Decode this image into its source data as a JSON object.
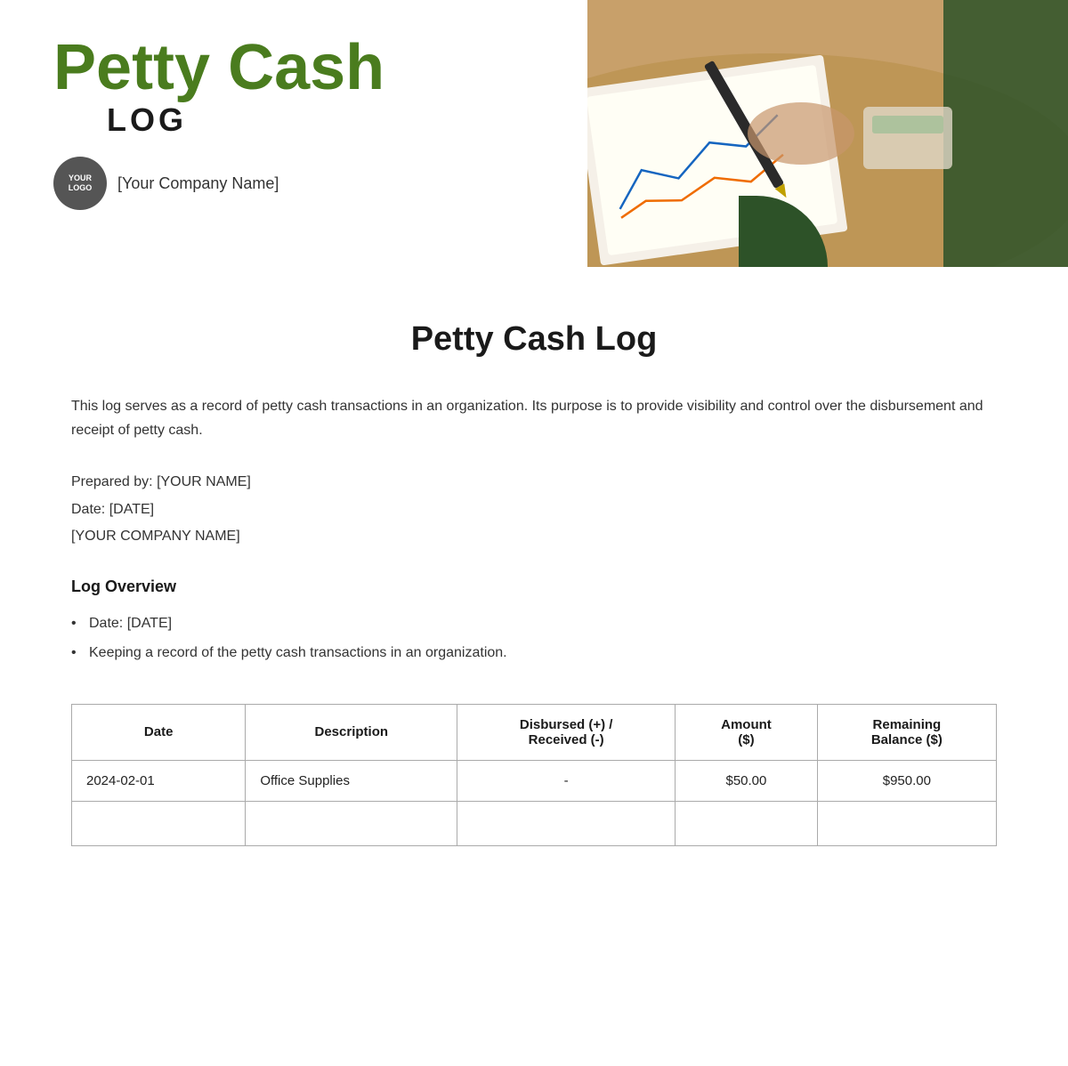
{
  "header": {
    "title_line1": "Petty Cash",
    "title_line2": "LOG",
    "logo_text_line1": "YOUR",
    "logo_text_line2": "LOGO",
    "company_name": "[Your Company Name]"
  },
  "document": {
    "main_title": "Petty Cash Log",
    "description": "This log serves as a record of petty cash transactions in an organization. Its purpose is to provide visibility and control over the disbursement and receipt of petty cash.",
    "prepared_by_label": "Prepared by:",
    "prepared_by_value": "[YOUR NAME]",
    "date_label": "Date:",
    "date_value": "[DATE]",
    "company_name_field": "[YOUR COMPANY NAME]",
    "section_heading": "Log Overview",
    "bullets": [
      "Date: [DATE]",
      "Keeping a record of the petty cash transactions in an organization."
    ]
  },
  "table": {
    "headers": [
      "Date",
      "Description",
      "Disbursed (+) / Received (-)",
      "Amount ($)",
      "Remaining Balance ($)"
    ],
    "rows": [
      {
        "date": "2024-02-01",
        "description": "Office Supplies",
        "disbursed": "-",
        "amount": "$50.00",
        "balance": "$950.00"
      },
      {
        "date": "",
        "description": "",
        "disbursed": "",
        "amount": "",
        "balance": ""
      }
    ]
  },
  "colors": {
    "green_dark": "#4a7c1e",
    "green_header": "#2d5228",
    "text_dark": "#1a1a1a"
  }
}
